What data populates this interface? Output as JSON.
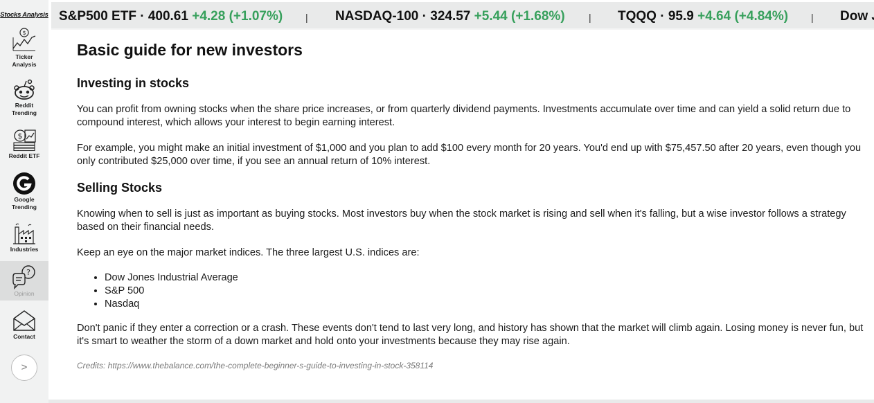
{
  "sidebar": {
    "brand": "Stocks Analysis",
    "items": [
      {
        "id": "ticker",
        "label_lines": [
          "Ticker",
          "Analysis"
        ],
        "icon": "ticker-chart-icon"
      },
      {
        "id": "reddit",
        "label_lines": [
          "Reddit",
          "Trending"
        ],
        "icon": "reddit-icon"
      },
      {
        "id": "reddit-etf",
        "label_lines": [
          "Reddit ETF"
        ],
        "icon": "money-stack-icon"
      },
      {
        "id": "google",
        "label_lines": [
          "Google",
          "Trending"
        ],
        "icon": "google-icon"
      },
      {
        "id": "industries",
        "label_lines": [
          "Industries"
        ],
        "icon": "factory-icon"
      },
      {
        "id": "opinion",
        "label_lines": [
          "Opinion"
        ],
        "icon": "opinion-chat-icon",
        "active": true
      },
      {
        "id": "contact",
        "label_lines": [
          "Contact"
        ],
        "icon": "envelope-icon"
      }
    ],
    "expand_label": ">"
  },
  "ticker": [
    {
      "name": "S&P500 ETF",
      "price": "400.61",
      "change": "+4.28 (+1.07%)"
    },
    {
      "name": "NASDAQ-100",
      "price": "324.57",
      "change": "+5.44 (+1.68%)"
    },
    {
      "name": "TQQQ",
      "price": "95.9",
      "change": "+4.64 (+4.84%)"
    },
    {
      "name": "Dow Jones",
      "price": "",
      "change": ""
    }
  ],
  "ticker_separator": "|",
  "ticker_dot": "·",
  "colors": {
    "positive": "#37a05c",
    "sidebar_bg": "#f1f2f2",
    "ticker_bg": "#e9eaea"
  },
  "article": {
    "title": "Basic guide for new investors",
    "section1_heading": "Investing in stocks",
    "p1": "You can profit from owning stocks when the share price increases, or from quarterly dividend payments. Investments accumulate over time and can yield a solid return due to compound interest, which allows your interest to begin earning interest.",
    "p2": "For example, you might make an initial investment of $1,000 and you plan to add $100 every month for 20 years. You'd end up with $75,457.50 after 20 years, even though you only contributed $25,000 over time, if you see an annual return of 10% interest.",
    "section2_heading": "Selling Stocks",
    "p3": "Knowing when to sell is just as important as buying stocks. Most investors buy when the stock market is rising and sell when it's falling, but a wise investor follows a strategy based on their financial needs.",
    "p4": "Keep an eye on the major market indices. The three largest U.S. indices are:",
    "indices": [
      "Dow Jones Industrial Average",
      "S&P 500",
      "Nasdaq"
    ],
    "p5": "Don't panic if they enter a correction or a crash. These events don't tend to last very long, and history has shown that the market will climb again. Losing money is never fun, but it's smart to weather the storm of a down market and hold onto your investments because they may rise again.",
    "credits": "Credits: https://www.thebalance.com/the-complete-beginner-s-guide-to-investing-in-stock-358114"
  }
}
